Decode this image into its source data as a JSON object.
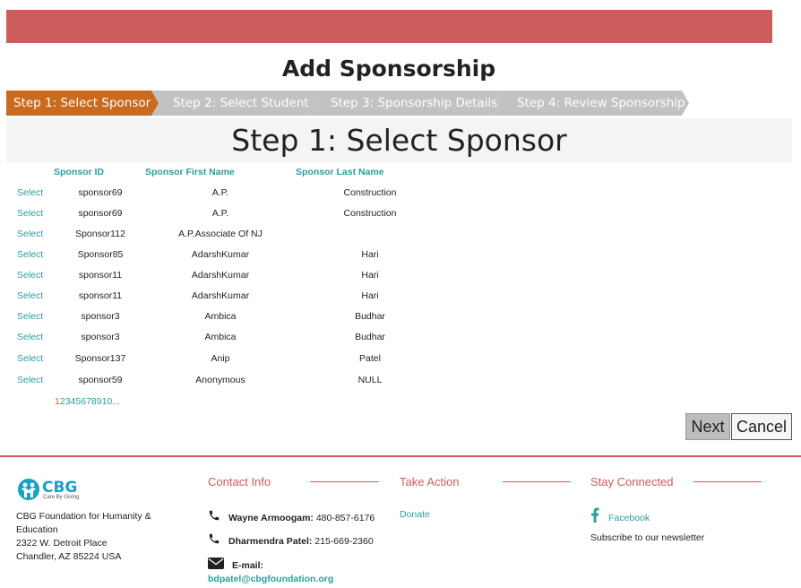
{
  "page": {
    "title": "Add Sponsorship"
  },
  "wizard": {
    "steps": [
      "Step 1: Select Sponsor",
      "Step 2: Select Student",
      "Step 3: Sponsorship Details",
      "Step 4: Review Sponsorship"
    ],
    "active_step": 1,
    "heading": "Step 1: Select Sponsor"
  },
  "grid": {
    "columns": [
      "Sponsor ID",
      "Sponsor First Name",
      "Sponsor Last Name"
    ],
    "select_label": "Select",
    "rows": [
      {
        "id": "sponsor69",
        "first": "A.P.",
        "last": "Construction"
      },
      {
        "id": "sponsor69",
        "first": "A.P.",
        "last": "Construction"
      },
      {
        "id": "Sponsor112",
        "first": "A.P.Associate Of NJ",
        "last": ""
      },
      {
        "id": "Sponsor85",
        "first": "AdarshKumar",
        "last": "Hari"
      },
      {
        "id": "sponsor11",
        "first": "AdarshKumar",
        "last": "Hari"
      },
      {
        "id": "sponsor11",
        "first": "AdarshKumar",
        "last": "Hari"
      },
      {
        "id": "sponsor3",
        "first": "Ambica",
        "last": "Budhar"
      },
      {
        "id": "sponsor3",
        "first": "Ambica",
        "last": "Budhar"
      },
      {
        "id": "Sponsor137",
        "first": "Anip",
        "last": "Patel"
      },
      {
        "id": "sponsor59",
        "first": "Anonymous",
        "last": "NULL"
      }
    ],
    "pager": {
      "current": "1",
      "pages": [
        "2",
        "3",
        "4",
        "5",
        "6",
        "7",
        "8",
        "9",
        "10"
      ],
      "more": "..."
    }
  },
  "buttons": {
    "next": "Next",
    "cancel": "Cancel"
  },
  "footer": {
    "logo": {
      "text": "CBG",
      "tagline": "Care By Giving"
    },
    "address": [
      "CBG Foundation for Humanity &",
      "Education",
      "2322 W. Detroit Place",
      "Chandler, AZ 85224 USA"
    ],
    "contact": {
      "title_a": "Contact",
      "title_b": "Info",
      "people": [
        {
          "name": "Wayne Armoogam:",
          "phone": "480-857-6176"
        },
        {
          "name": "Dharmendra Patel:",
          "phone": "215-669-2360"
        }
      ],
      "email_label": "E-mail:",
      "email": "bdpatel@cbgfoundation.org"
    },
    "action": {
      "title_a": "Take",
      "title_b": "Action",
      "donate": "Donate"
    },
    "connected": {
      "title_a": "Stay",
      "title_b": "Connected",
      "facebook": "Facebook",
      "newsletter": "Subscribe to our newsletter"
    }
  },
  "colors": {
    "brand_red": "#cd5c5c",
    "step_active": "#c96a1e",
    "step_inactive": "#c2c2c2",
    "link_teal": "#2a9d9d"
  }
}
